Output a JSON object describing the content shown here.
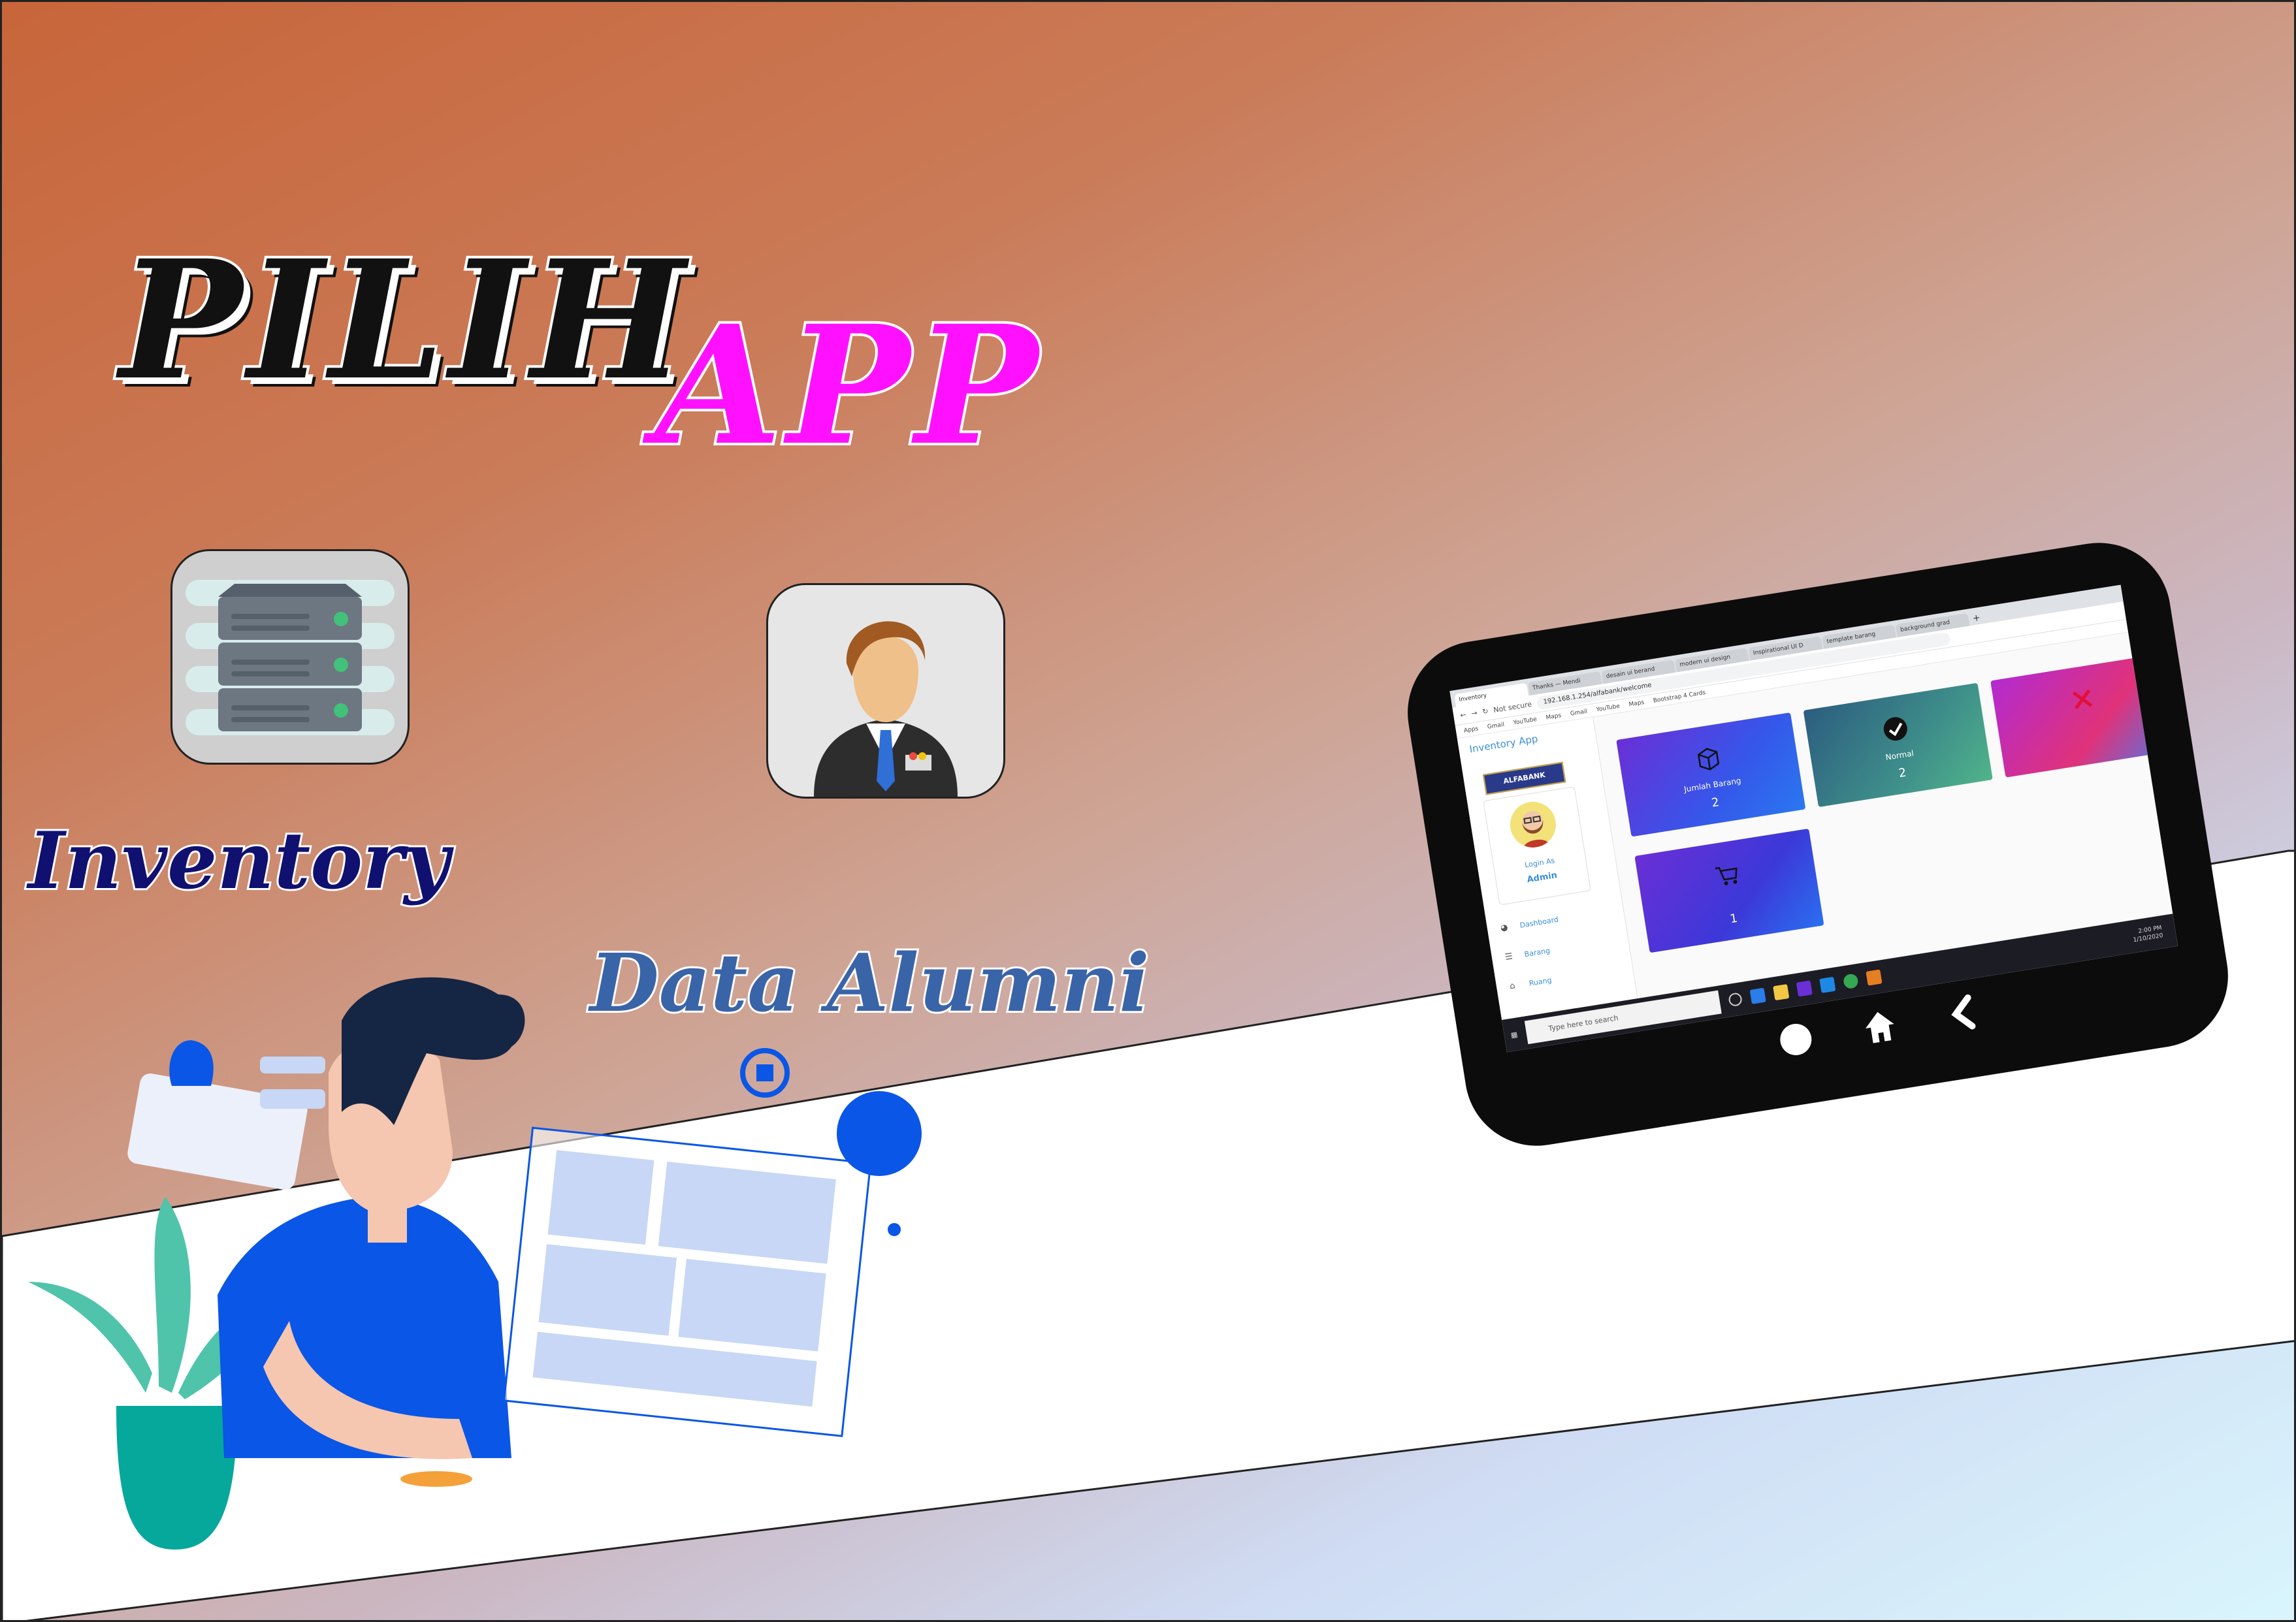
{
  "poster": {
    "title_word1": "PILIH",
    "title_word2": "APP",
    "title_color_1": "#111111",
    "title_color_2": "#ff11ff"
  },
  "apps": [
    {
      "label": "Inventory",
      "icon": "server-icon",
      "color": "#101070"
    },
    {
      "label": "Data Alumni",
      "icon": "user-profile-icon",
      "color": "#3a64a8"
    }
  ],
  "tablet": {
    "browser": {
      "tabs": [
        "Inventory",
        "Thanks — Mendi",
        "desain ui berand",
        "modern ui design",
        "Inspirational UI D",
        "template barang",
        "background grad"
      ],
      "new_tab": "+",
      "url_prefix": "Not secure",
      "url": "192.168.1.254/alfabank/welcome",
      "bookmarks": [
        "Apps",
        "Gmail",
        "YouTube",
        "Maps",
        "Gmail",
        "YouTube",
        "Maps",
        "Bootstrap 4 Cards"
      ]
    },
    "app": {
      "title": "Inventory App",
      "logo": "ALFABANK",
      "login_as": "Login As",
      "login_role": "Admin",
      "menu": [
        "Dashboard",
        "Barang",
        "Ruang"
      ],
      "cards": [
        {
          "label": "Jumlah Barang",
          "value": "2",
          "icon": "box-icon"
        },
        {
          "label": "Normal",
          "value": "2",
          "icon": "check-icon"
        },
        {
          "label": "",
          "value": "",
          "icon": "x-icon"
        },
        {
          "label": "",
          "value": "1",
          "icon": "cart-icon"
        }
      ]
    },
    "taskbar": {
      "search_placeholder": "Type here to search",
      "time": "2:00 PM",
      "date": "1/10/2020"
    }
  }
}
